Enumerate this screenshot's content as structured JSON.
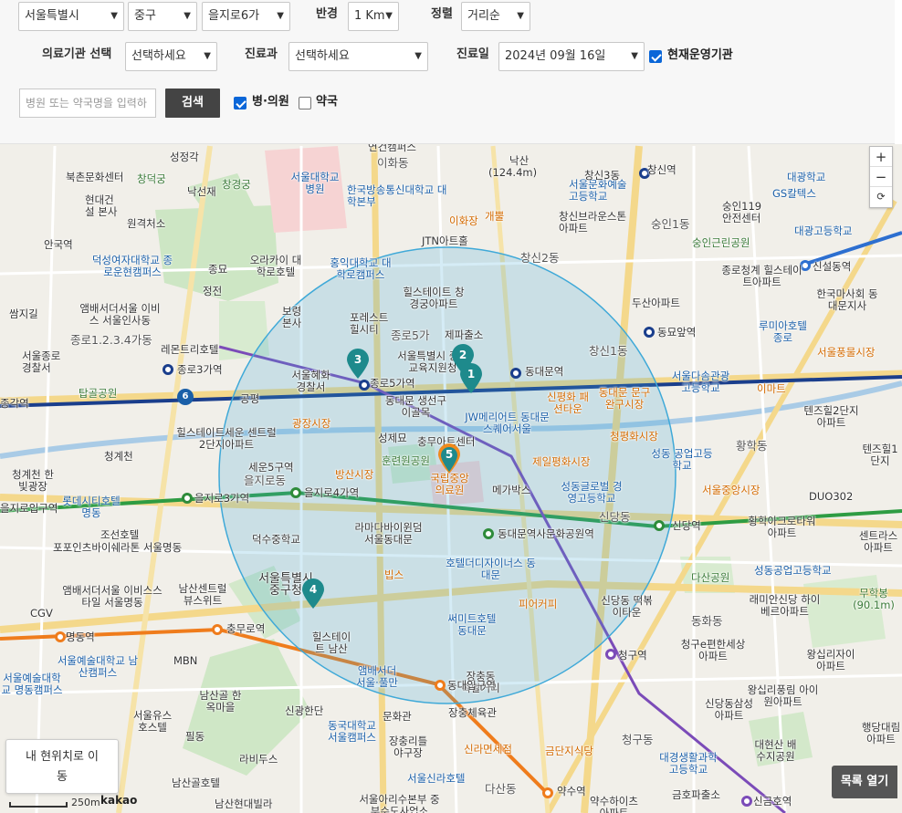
{
  "filters": {
    "region_city": "서울특별시",
    "region_gu": "중구",
    "region_dong": "을지로6가",
    "radius_label": "반경",
    "radius_value": "1 Km",
    "sort_label": "정렬",
    "sort_value": "거리순",
    "institution_label": "의료기관 선택",
    "institution_value": "선택하세요",
    "department_label": "진료과",
    "department_value": "선택하세요",
    "date_label": "진료일",
    "date_value": "2024년 09월 16일",
    "open_now_label": "현재운영기관",
    "open_now_checked": true,
    "search_placeholder": "병원 또는 약국명을 입력하",
    "search_button": "검색",
    "hospital_label": "병·의원",
    "hospital_checked": true,
    "pharmacy_label": "약국",
    "pharmacy_checked": false
  },
  "map": {
    "zoom_in": "+",
    "zoom_out": "−",
    "reset": "⟳",
    "my_location_line1": "내 현위치로 이",
    "my_location_line2": "동",
    "list_open": "목록 열기",
    "scale_label": "250m",
    "brand": "kakao",
    "circle_color": "#3fa9d8",
    "pin_color": "#1e8a8c",
    "highlight_pin_color": "#f08a1c",
    "pins": [
      {
        "num": "1"
      },
      {
        "num": "2"
      },
      {
        "num": "3"
      },
      {
        "num": "4"
      },
      {
        "num": "5"
      }
    ],
    "route_badge": "6",
    "places": {
      "p1": "연건캠퍼스",
      "p2": "이화동",
      "p3": "낙산",
      "p4": "(124.4m)",
      "p5": "성정각",
      "p6": "창덕궁",
      "p7": "북촌문화센터",
      "p8": "낙선재",
      "p9": "창경궁",
      "p10": "서울대학교병원",
      "p11": "한국방송통신대학교 대학본부",
      "p12": "서울문화예술 고등학교",
      "p13": "창신역",
      "p14": "창신3동",
      "p15": "현대건설 본사",
      "p16": "원격처소",
      "p17": "이화장",
      "p18": "개뿔",
      "p19": "창신브라운스톤 아파트",
      "p20": "숭인1동",
      "p21": "숭인119 안전센터",
      "p22": "GS칼텍스",
      "p23": "대광학교",
      "p24": "대광고등학교",
      "p25": "안국역",
      "p26": "JTN아트홀",
      "p27": "숭인근린공원",
      "p28": "덕성여자대학교 종로운현캠퍼스",
      "p29": "종묘",
      "p30": "오라카이 대학로호텔",
      "p31": "홍익대학교 대학로캠퍼스",
      "p32": "창신2동",
      "p33": "종로청계 힐스테이트아파트",
      "p34": "신설동역",
      "p35": "앰배서더서울 이비스 서울인사동",
      "p36": "정전",
      "p37": "힐스테이트 창경궁아파트",
      "p38": "두산아파트",
      "p39": "한국마사회 동대문지사",
      "p40": "쌈지길",
      "p41": "보령 본사",
      "p42": "포레스트 힐시티",
      "p43": "종로5가",
      "p44": "제파출소",
      "p45": "동묘앞역",
      "p46": "루미아호텔 종로",
      "p47": "종로1.2.3.4가동",
      "p48": "레몬트리호텔",
      "p49": "서울종로 경찰서",
      "p50": "종로3가역",
      "p51": "서울특별시 중부교육지원청",
      "p52": "창신1동",
      "p53": "서울풍물시장",
      "p54": "서울혜화 경찰서",
      "p55": "종로5가역",
      "p56": "동대문역",
      "p57": "서울다솜관광 고등학교",
      "p58": "탑골공원",
      "p59": "종각역",
      "p60": "공평",
      "p61": "동대문 생선구이골목",
      "p62": "신평화 패션타운",
      "p63": "동대문 문구 완구시장",
      "p64": "이마트",
      "p65": "텐즈힐2단지 아파트",
      "p66": "JW메리어트 동대문스퀘어서울",
      "p67": "광장시장",
      "p68": "청평화시장",
      "p69": "힐스테이트세운 센트럴2단지아파트",
      "p70": "청계천",
      "p71": "성제묘",
      "p72": "충무아트센터",
      "p73": "황학동",
      "p74": "텐즈힐1단지",
      "p75": "훈련원공원",
      "p76": "제일평화시장",
      "p77": "성동 공업고등학교",
      "p78": "세운5구역",
      "p79": "을지로동",
      "p80": "방산시장",
      "p81": "청계천 한빛광장",
      "p82": "국립중앙의료원",
      "p83": "메가박스",
      "p84": "성동글로벌 경영고등학교",
      "p85": "서울중앙시장",
      "p86": "DUO302",
      "p87": "을지로3가역",
      "p88": "을지로4가역",
      "p89": "을지로입구역",
      "p90": "롯데시티호텔 명동",
      "p91": "신당동",
      "p92": "신당역",
      "p93": "황학아크로타워 아파트",
      "p94": "센트라스 아파트",
      "p95": "조선호텔",
      "p96": "포포인츠바이쉐라톤 서울명동",
      "p97": "라마다바이윈덤 서울동대문",
      "p98": "동대문역사문화공원역",
      "p99": "덕수중학교",
      "p100": "서울특별시 중구청",
      "p101": "빕스",
      "p102": "호텔더디자이너스 동대문",
      "p103": "성동공업고등학교",
      "p104": "다산공원",
      "p105": "앰배서더서울 이비스스타일 서울명동",
      "p106": "남산센트럴 뷰스위트",
      "p107": "피어커피",
      "p108": "신당동 떡볶이타운",
      "p109": "래미안신당 하이베르아파트",
      "p110": "무학봉 (90.1m)",
      "p111": "CGV",
      "p112": "충무로역",
      "p113": "명동역",
      "p114": "힐스테이트 남산",
      "p115": "써미트호텔 동대문",
      "p116": "동화동",
      "p117": "청구e편한세상 아파트",
      "p118": "왕십리자이 아파트",
      "p119": "서울예술대학교 남산캠퍼스",
      "p120": "MBN",
      "p121": "장충동 족발거리",
      "p122": "청구역",
      "p123": "서울예술대학교 명동캠퍼스",
      "p124": "남산골 한옥마을",
      "p125": "앰배서더 서울·풀만",
      "p126": "동대입구역",
      "p127": "왕십리풍림 아이원아파트",
      "p128": "신당동삼성 아파트",
      "p129": "서울유스 호스텔",
      "p130": "신광한단",
      "p131": "문화관",
      "p132": "동국대학교 서울캠퍼스",
      "p133": "장충체육관",
      "p134": "필동",
      "p135": "장충리틀 야구장",
      "p136": "신라면세점",
      "p137": "금단지식당",
      "p138": "청구동",
      "p139": "대경생활과학 고등학교",
      "p140": "대현산 배수지공원",
      "p141": "행당대림 아파트",
      "p142": "라비두스",
      "p143": "남산골호텔",
      "p144": "서울신라호텔",
      "p145": "다산동",
      "p146": "약수역",
      "p147": "금호파출소",
      "p148": "신금호역",
      "p149": "남산현대빌라",
      "p150": "서울아리수본부 중부수도사업소",
      "p151": "약수하이츠 아파트",
      "p152": "행당"
    }
  }
}
